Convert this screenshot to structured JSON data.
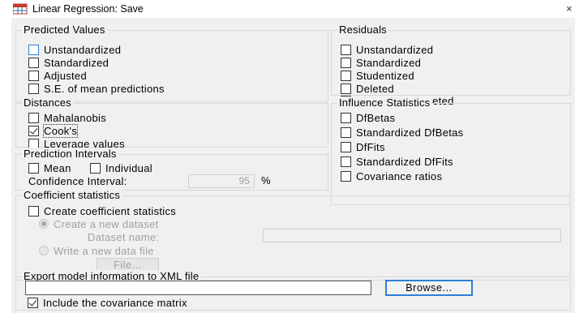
{
  "window": {
    "title": "Linear Regression: Save",
    "close_glyph": "×",
    "icon": "spss-table-icon"
  },
  "predicted_values": {
    "legend": "Predicted Values",
    "items": [
      {
        "label": "Unstandardized",
        "checked": false
      },
      {
        "label": "Standardized",
        "checked": false
      },
      {
        "label": "Adjusted",
        "checked": false
      },
      {
        "label": "S.E. of mean predictions",
        "checked": false
      }
    ]
  },
  "residuals": {
    "legend": "Residuals",
    "items": [
      {
        "label": "Unstandardized",
        "checked": false
      },
      {
        "label": "Standardized",
        "checked": false
      },
      {
        "label": "Studentized",
        "checked": false
      },
      {
        "label": "Deleted",
        "checked": false
      },
      {
        "label": "Studentized deleted",
        "checked": false
      }
    ]
  },
  "distances": {
    "legend": "Distances",
    "items": [
      {
        "label": "Mahalanobis",
        "checked": false
      },
      {
        "label": "Cook's",
        "checked": true
      },
      {
        "label": "Leverage values",
        "checked": false
      }
    ]
  },
  "influence": {
    "legend": "Influence Statistics",
    "items": [
      {
        "label": "DfBetas",
        "checked": false
      },
      {
        "label": "Standardized DfBetas",
        "checked": false
      },
      {
        "label": "DfFits",
        "checked": false
      },
      {
        "label": "Standardized DfFits",
        "checked": false
      },
      {
        "label": "Covariance ratios",
        "checked": false
      }
    ]
  },
  "prediction_intervals": {
    "legend": "Prediction Intervals",
    "mean_label": "Mean",
    "individual_label": "Individual",
    "ci_label": "Confidence Interval:",
    "ci_value": "95",
    "ci_unit": "%"
  },
  "coefficient_statistics": {
    "legend": "Coefficient statistics",
    "create_label": "Create coefficient statistics",
    "new_dataset_label": "Create a new dataset",
    "dataset_name_label": "Dataset name:",
    "dataset_name_value": "",
    "write_file_label": "Write a new data file",
    "file_button": "File..."
  },
  "export": {
    "legend": "Export model information to XML file",
    "path_value": "",
    "browse_button": "Browse...",
    "include_cov_label": "Include the covariance matrix",
    "include_cov_checked": true
  },
  "colors": {
    "dialog_bg": "#f0f0f0",
    "focus_blue": "#2f7fd6",
    "group_border": "#d8d8d8"
  }
}
